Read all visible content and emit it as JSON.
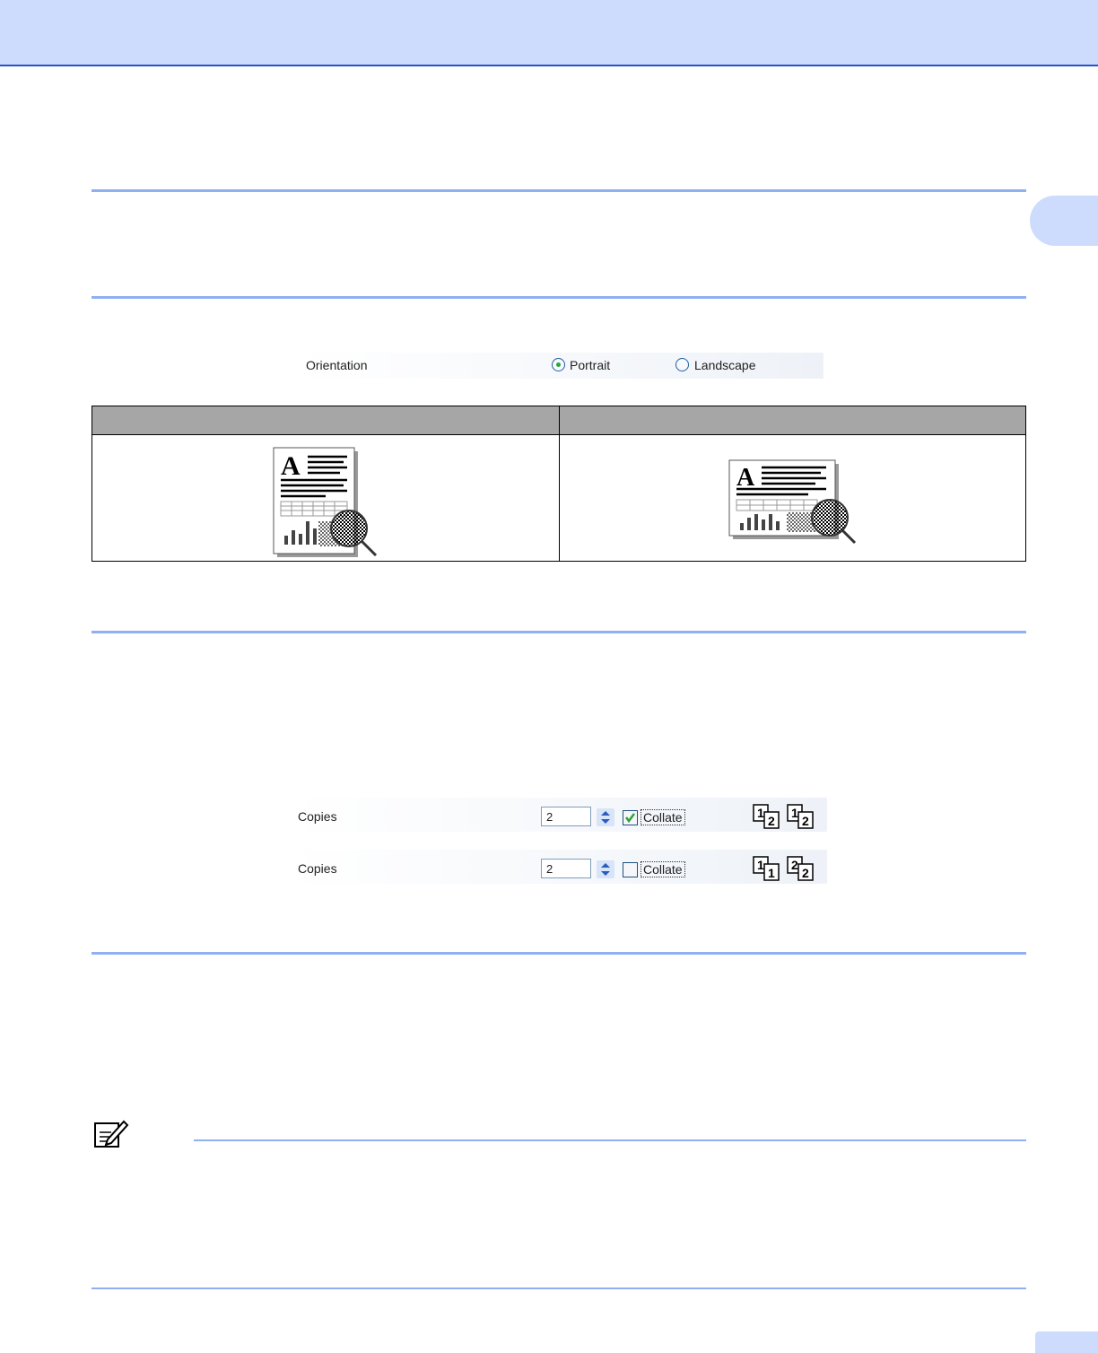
{
  "orientation": {
    "label": "Orientation",
    "options": [
      {
        "label": "Portrait",
        "selected": true
      },
      {
        "label": "Landscape",
        "selected": false
      }
    ]
  },
  "copies": [
    {
      "label": "Copies",
      "value": "2",
      "collate_label": "Collate",
      "collate_checked": true,
      "sequence": [
        "1",
        "2",
        "1",
        "2"
      ]
    },
    {
      "label": "Copies",
      "value": "2",
      "collate_label": "Collate",
      "collate_checked": false,
      "sequence": [
        "1",
        "1",
        "2",
        "2"
      ]
    }
  ],
  "colors": {
    "header_band": "#cddcfc",
    "header_rule": "#2b53c8",
    "section_rule": "#8fb0f2",
    "table_header": "#a6a6a6",
    "check_green": "#2ea33a"
  },
  "icons": {
    "note": "pencil-note-icon",
    "spin": "up-down-arrows-icon"
  }
}
